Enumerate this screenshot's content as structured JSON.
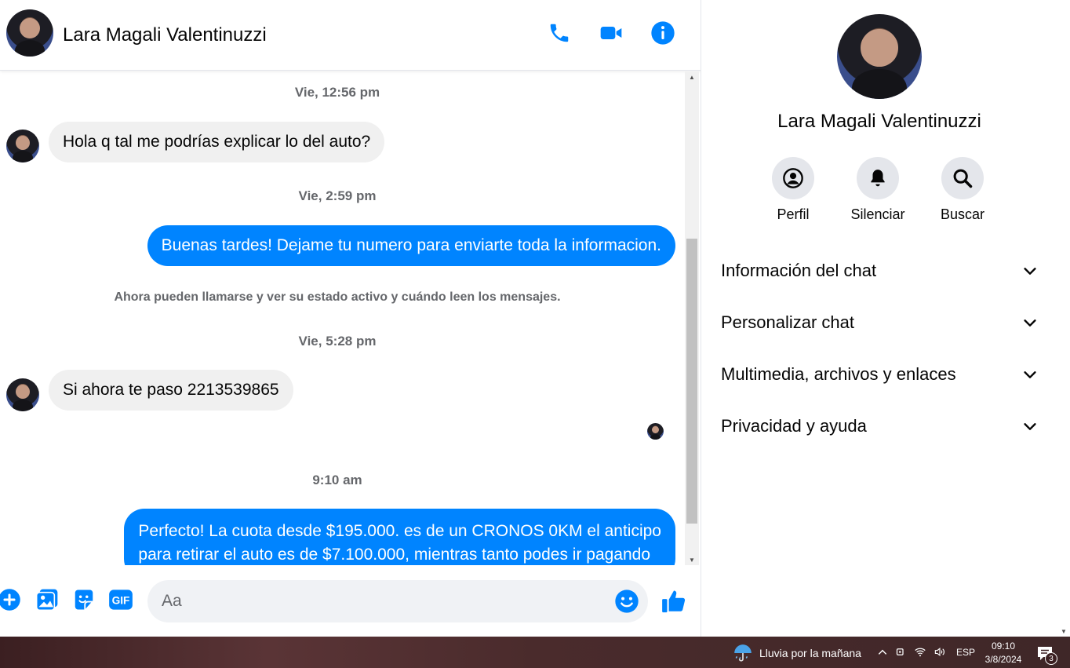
{
  "header": {
    "contact_name": "Lara Magali Valentinuzzi",
    "icons": [
      "phone-icon",
      "video-camera-icon",
      "info-icon"
    ],
    "accent_color": "#0084ff"
  },
  "messages": {
    "ts1": "Vie, 12:56 pm",
    "msg1": "Hola q tal me podrías explicar lo del auto?",
    "ts2": "Vie, 2:59 pm",
    "msg2": "Buenas tardes! Dejame tu numero para enviarte toda la informacion.",
    "system_note": "Ahora pueden llamarse y ver su estado activo y cuándo leen los mensajes.",
    "ts3": "Vie, 5:28 pm",
    "msg3": "Si ahora te paso 2213539865",
    "ts4": "9:10 am",
    "msg4_line1": "Perfecto! La cuota desde $195.000. es de un CRONOS 0KM el anticipo",
    "msg4_line2": "para retirar el auto es de $7.100.000, mientras tanto podes ir pagando"
  },
  "composer": {
    "placeholder": "Aa",
    "icons": [
      "plus-circle-icon",
      "gallery-icon",
      "sticker-icon",
      "gif-icon",
      "emoji-icon",
      "thumbs-up-icon"
    ],
    "gif_label": "GIF"
  },
  "panel": {
    "contact_name": "Lara Magali Valentinuzzi",
    "actions": [
      {
        "label": "Perfil",
        "icon": "profile-icon"
      },
      {
        "label": "Silenciar",
        "icon": "bell-icon"
      },
      {
        "label": "Buscar",
        "icon": "search-icon"
      }
    ],
    "sections": [
      "Información del chat",
      "Personalizar chat",
      "Multimedia, archivos y enlaces",
      "Privacidad y ayuda"
    ]
  },
  "taskbar": {
    "weather": "Lluvia por la mañana",
    "language": "ESP",
    "time": "09:10",
    "date": "3/8/2024",
    "notification_count": "3"
  }
}
